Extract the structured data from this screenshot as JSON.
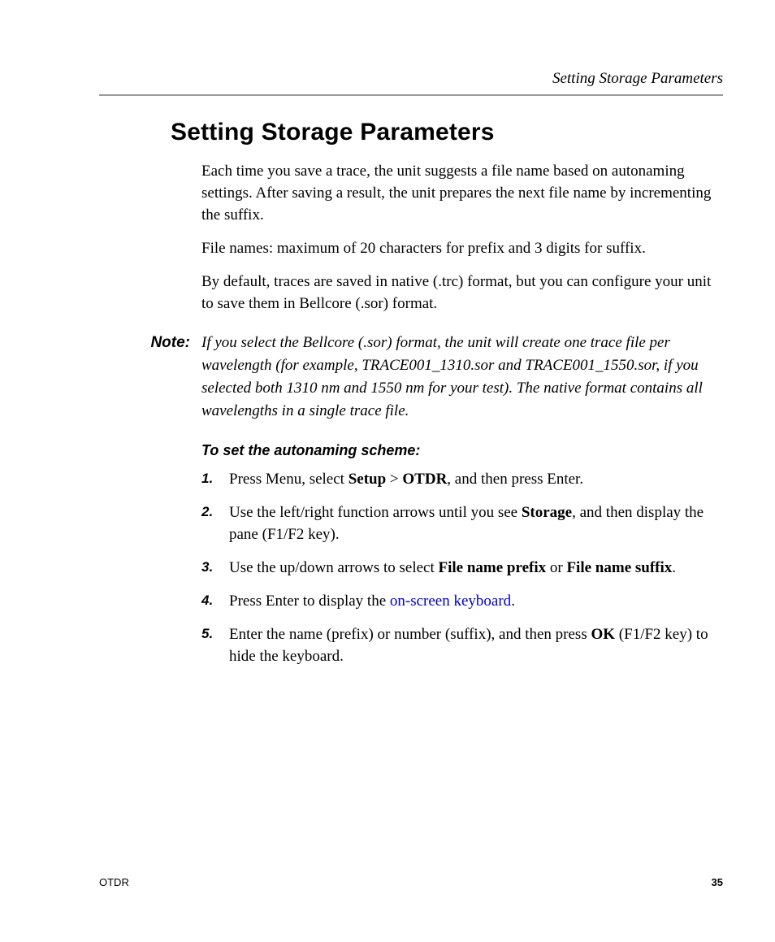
{
  "running_head": "Setting Storage Parameters",
  "title": "Setting Storage Parameters",
  "paragraphs": {
    "p1": "Each time you save a trace, the unit suggests a file name based on autonaming settings. After saving a result, the unit prepares the next file name by incrementing the suffix.",
    "p2": "File names: maximum of 20 characters for prefix and 3 digits for suffix.",
    "p3": "By default, traces are saved in native (.trc) format, but you can configure your unit to save them in Bellcore (.sor) format."
  },
  "note": {
    "label": "Note:",
    "body": "If you select the Bellcore (.sor) format, the unit will create one trace file per wavelength (for example, TRACE001_1310.sor and TRACE001_1550.sor, if you selected both 1310 nm and 1550 nm for your test). The native format contains all wavelengths in a single trace file."
  },
  "procedure_title": "To set the autonaming scheme:",
  "steps": [
    {
      "pre": "Press Menu, select ",
      "b1": "Setup",
      "mid1": " > ",
      "b2": "OTDR",
      "post": ", and then press Enter."
    },
    {
      "pre": "Use the left/right function arrows until you see ",
      "b1": "Storage",
      "post": ", and then display the pane (F1/F2 key)."
    },
    {
      "pre": "Use the up/down arrows to select ",
      "b1": "File name prefix",
      "mid1": " or ",
      "b2": "File name suffix",
      "post": "."
    },
    {
      "pre": "Press Enter to display the ",
      "link": "on-screen keyboard",
      "post": "."
    },
    {
      "pre": "Enter the name (prefix) or number (suffix), and then press ",
      "b1": "OK",
      "post": " (F1/F2 key) to hide the keyboard."
    }
  ],
  "footer": {
    "left": "OTDR",
    "right": "35"
  }
}
